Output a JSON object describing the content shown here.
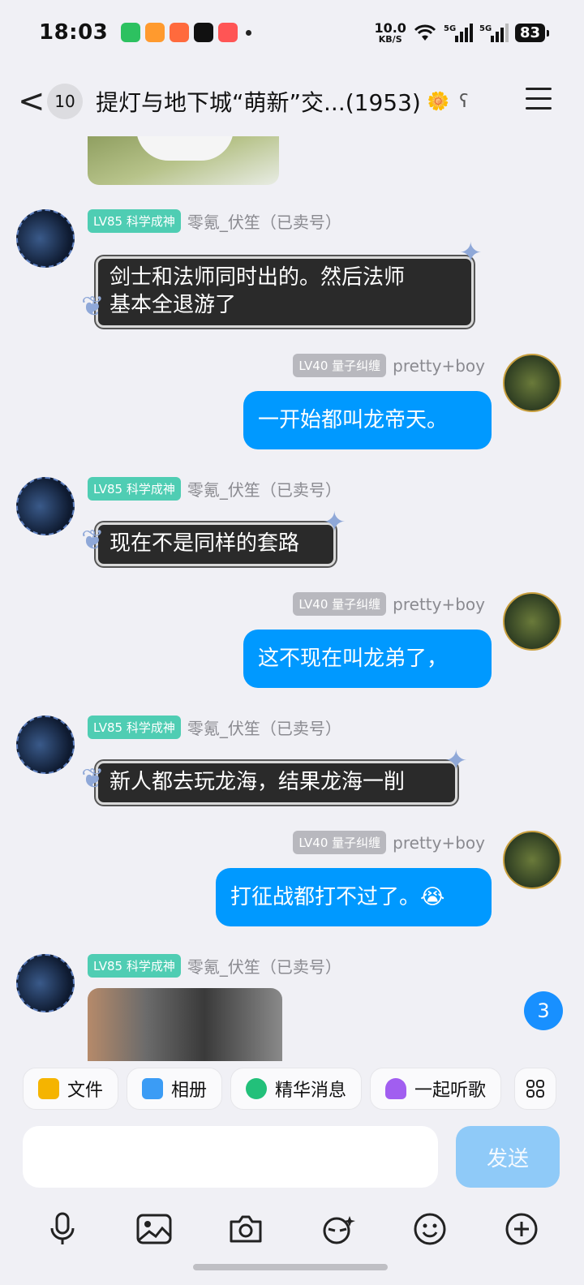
{
  "status_bar": {
    "time": "18:03",
    "net_speed_value": "10.0",
    "net_speed_unit": "KB/S",
    "battery": "83",
    "signal_label_1": "5G",
    "signal_label_2": "5G"
  },
  "header": {
    "back_label": "<",
    "unread_count": "10",
    "title": "提灯与地下城“萌新”交...(1953)"
  },
  "messages": [
    {
      "side": "left",
      "level": "LV85",
      "badge": "科学成神",
      "name": "零氪_伏笙（已卖号）",
      "text_line1": "剑士和法师同时出的。然后法师",
      "text_line2": "基本全退游了"
    },
    {
      "side": "right",
      "level": "LV40",
      "badge": "量子纠缠",
      "name": "pretty+boy",
      "text": "一开始都叫龙帝天。"
    },
    {
      "side": "left",
      "level": "LV85",
      "badge": "科学成神",
      "name": "零氪_伏笙（已卖号）",
      "text": "现在不是同样的套路"
    },
    {
      "side": "right",
      "level": "LV40",
      "badge": "量子纠缠",
      "name": "pretty+boy",
      "text": "这不现在叫龙弟了，"
    },
    {
      "side": "left",
      "level": "LV85",
      "badge": "科学成神",
      "name": "零氪_伏笙（已卖号）",
      "text": "新人都去玩龙海，结果龙海一削"
    },
    {
      "side": "right",
      "level": "LV40",
      "badge": "量子纠缠",
      "name": "pretty+boy",
      "text": "打征战都打不过了。😭"
    },
    {
      "side": "left",
      "level": "LV85",
      "badge": "科学成神",
      "name": "零氪_伏笙（已卖号）"
    }
  ],
  "new_msg_count": "3",
  "quickbar": {
    "file": "文件",
    "album": "相册",
    "highlights": "精华消息",
    "listen": "一起听歌"
  },
  "composer": {
    "send_label": "发送"
  },
  "colors": {
    "accent": "#0099ff",
    "send_disabled": "#8fcaf8",
    "badge_green": "#4fcdb3",
    "badge_gray": "#b8b8be"
  }
}
